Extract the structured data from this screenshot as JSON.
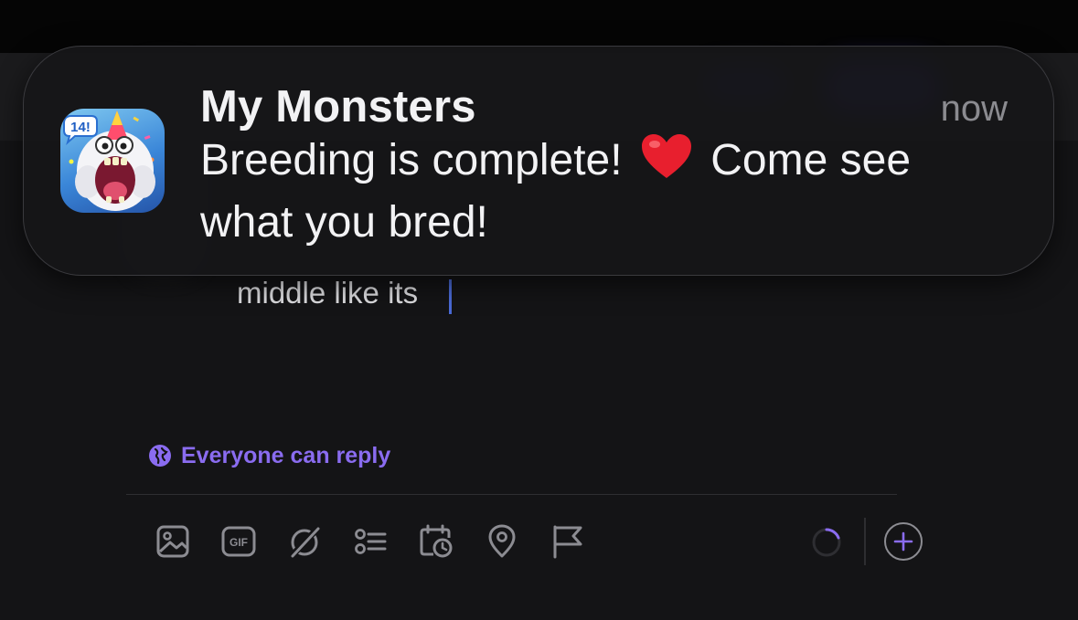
{
  "notification": {
    "app_name": "My Monsters",
    "time": "now",
    "body_before_emoji": "Breeding is complete! ",
    "emoji": "red-heart-emoji",
    "body_after_emoji": " Come see what you bred!",
    "icon": "my-monsters-app-icon",
    "icon_badge_text": "14!"
  },
  "compose": {
    "text": "middle like its"
  },
  "reply_setting": {
    "icon": "globe-icon",
    "label": "Everyone can reply"
  },
  "toolbar": {
    "items": [
      {
        "name": "image-icon"
      },
      {
        "name": "gif-icon",
        "label": "GIF"
      },
      {
        "name": "grok-icon"
      },
      {
        "name": "poll-icon"
      },
      {
        "name": "schedule-icon"
      },
      {
        "name": "location-icon"
      },
      {
        "name": "flag-icon"
      }
    ],
    "character_progress": "spinner",
    "add_button_icon": "plus-icon"
  },
  "colors": {
    "accent": "#8a6cf0",
    "background": "#141416",
    "icon_gray": "#8c8c92",
    "caret": "#4a6ad6"
  }
}
